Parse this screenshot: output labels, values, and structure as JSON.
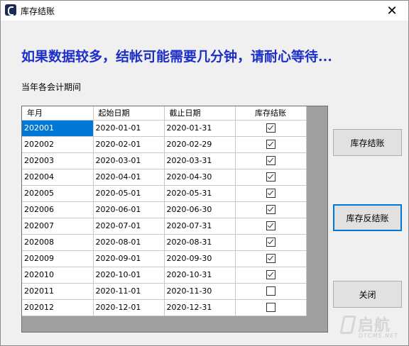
{
  "window": {
    "title": "库存结账",
    "close_symbol": "✕"
  },
  "headline": "如果数据较多，结帐可能需要几分钟，请耐心等待...",
  "period_label": "当年各会计期间",
  "table": {
    "columns": [
      "年月",
      "起始日期",
      "截止日期",
      "库存结账"
    ],
    "rows": [
      {
        "period": "202001",
        "start": "2020-01-01",
        "end": "2020-01-31",
        "closed": true,
        "selected": true
      },
      {
        "period": "202002",
        "start": "2020-02-01",
        "end": "2020-02-29",
        "closed": true
      },
      {
        "period": "202003",
        "start": "2020-03-01",
        "end": "2020-03-31",
        "closed": true
      },
      {
        "period": "202004",
        "start": "2020-04-01",
        "end": "2020-04-30",
        "closed": true
      },
      {
        "period": "202005",
        "start": "2020-05-01",
        "end": "2020-05-31",
        "closed": true
      },
      {
        "period": "202006",
        "start": "2020-06-01",
        "end": "2020-06-30",
        "closed": true
      },
      {
        "period": "202007",
        "start": "2020-07-01",
        "end": "2020-07-31",
        "closed": true
      },
      {
        "period": "202008",
        "start": "2020-08-01",
        "end": "2020-08-31",
        "closed": true
      },
      {
        "period": "202009",
        "start": "2020-09-01",
        "end": "2020-09-30",
        "closed": true
      },
      {
        "period": "202010",
        "start": "2020-10-01",
        "end": "2020-10-31",
        "closed": true
      },
      {
        "period": "202011",
        "start": "2020-11-01",
        "end": "2020-11-30",
        "closed": false
      },
      {
        "period": "202012",
        "start": "2020-12-01",
        "end": "2020-12-31",
        "closed": false
      }
    ]
  },
  "buttons": {
    "close_inventory": "库存结账",
    "reverse_close": "库存反结账",
    "close": "关闭"
  },
  "watermark": {
    "text": "启航",
    "sub": "DTCMS.NET"
  },
  "colors": {
    "headline": "#1d2fc8",
    "selection": "#0078d7",
    "focus_border": "#0078d7"
  }
}
